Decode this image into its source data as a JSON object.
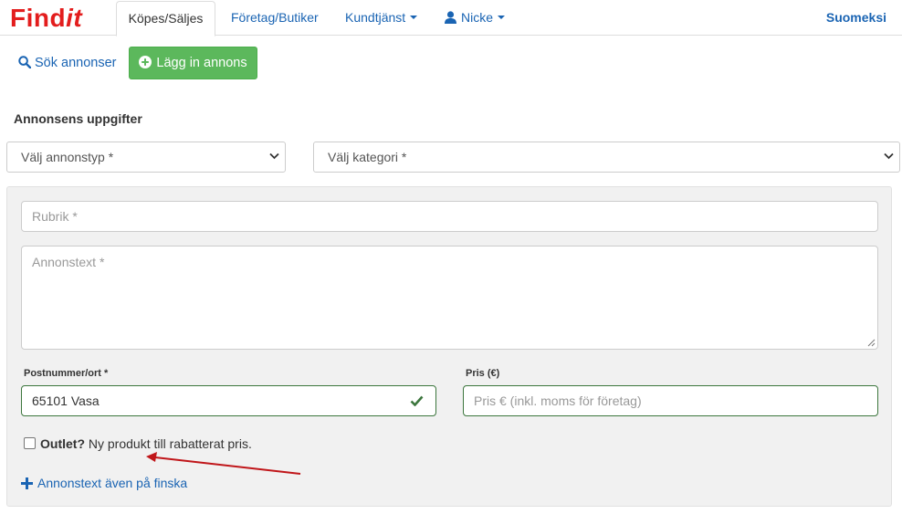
{
  "brand": {
    "logo_main": "Find",
    "logo_accent": "it",
    "color": "#e31d1d"
  },
  "nav": {
    "tabs": [
      {
        "label": "Köpes/Säljes",
        "active": true
      },
      {
        "label": "Företag/Butiker"
      },
      {
        "label": "Kundtjänst"
      },
      {
        "label": "Nicke"
      }
    ],
    "language": "Suomeksi"
  },
  "actions": {
    "search_label": "Sök annonser",
    "add_label": "Lägg in annons"
  },
  "form": {
    "section_title": "Annonsens uppgifter",
    "type_select": "Välj annonstyp *",
    "category_select": "Välj kategori *",
    "rubrik_placeholder": "Rubrik *",
    "annonstext_placeholder": "Annonstext *",
    "postnr_label": "Postnummer/ort *",
    "postnr_value": "65101 Vasa",
    "pris_label": "Pris (€)",
    "pris_placeholder": "Pris € (inkl. moms för företag)",
    "outlet_bold": "Outlet?",
    "outlet_text": " Ny produkt till rabatterat pris.",
    "finska_link": "Annonstext även på finska"
  },
  "colors": {
    "link": "#1a64b3",
    "success": "#5cb85c",
    "valid": "#3c763d",
    "annotation_arrow": "#c0161a"
  }
}
